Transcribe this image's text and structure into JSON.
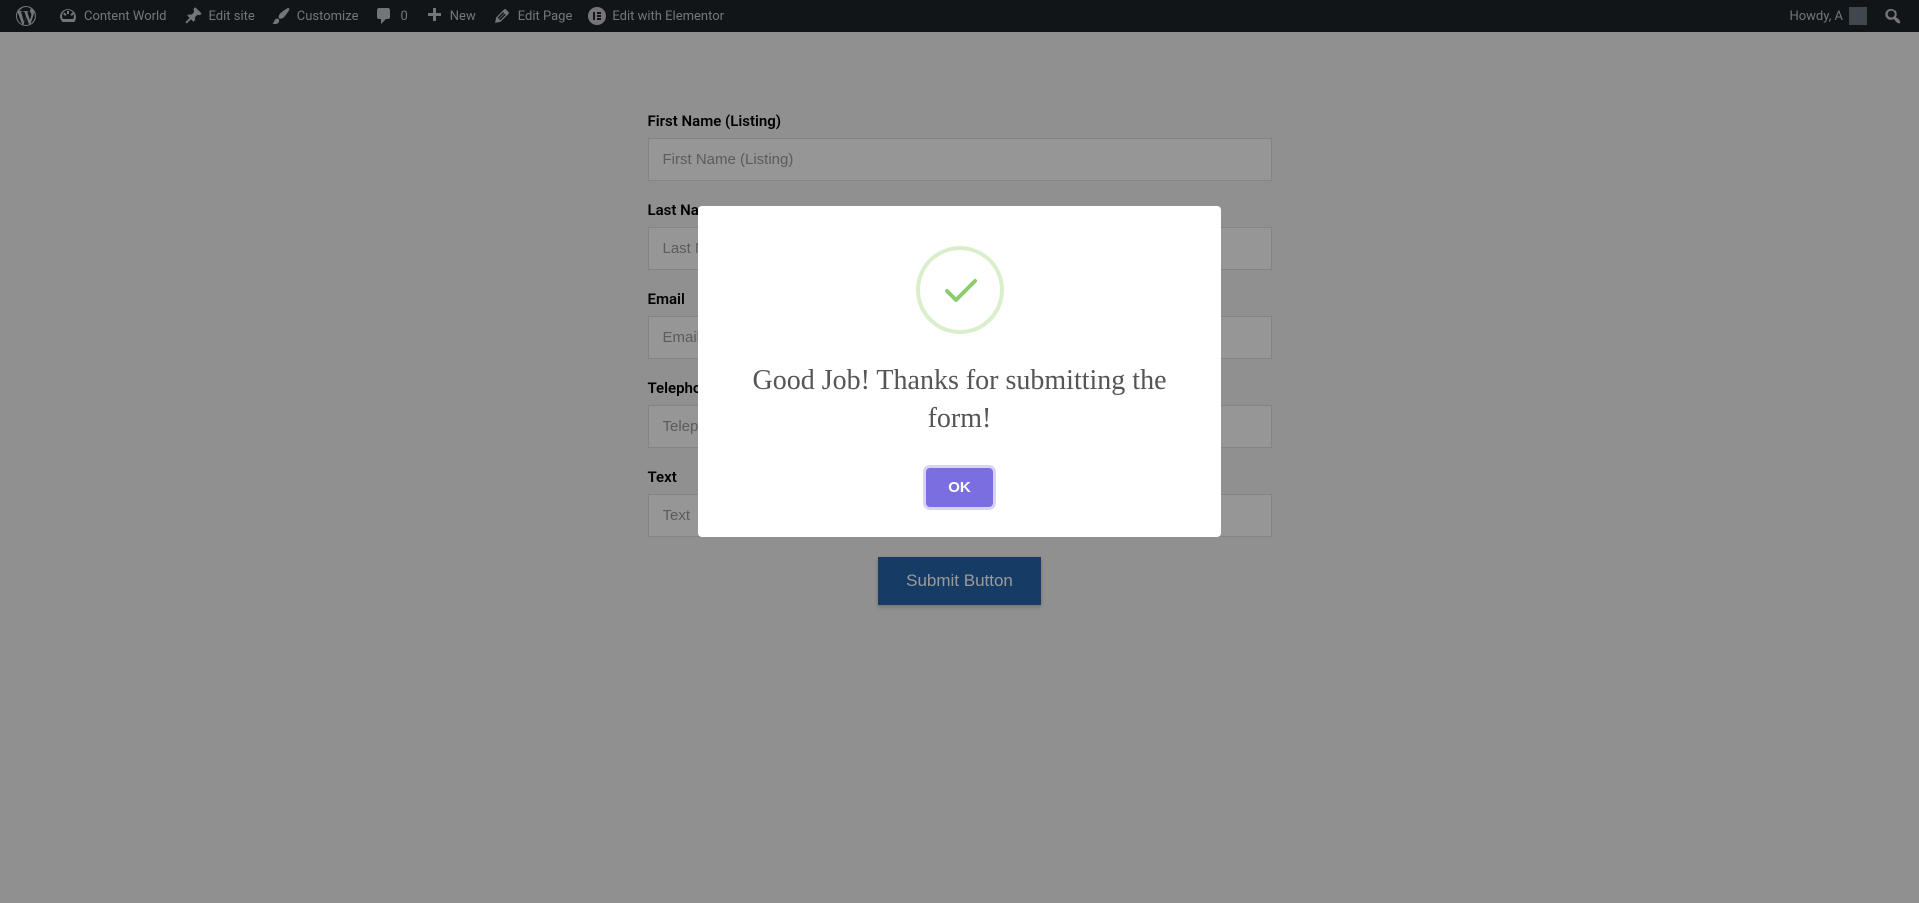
{
  "admin_bar": {
    "site_name": "Content World",
    "edit_site": "Edit site",
    "customize": "Customize",
    "comments_count": "0",
    "new": "New",
    "edit_page": "Edit Page",
    "edit_elementor": "Edit with Elementor",
    "greeting": "Howdy, A"
  },
  "form": {
    "fields": [
      {
        "label": "First Name (Listing)",
        "placeholder": "First Name (Listing)"
      },
      {
        "label": "Last Name",
        "placeholder": "Last Name"
      },
      {
        "label": "Email",
        "placeholder": "Email"
      },
      {
        "label": "Telephone",
        "placeholder": "Telephone"
      },
      {
        "label": "Text",
        "placeholder": "Text"
      }
    ],
    "submit_label": "Submit Button"
  },
  "modal": {
    "title": "Good Job! Thanks for submitting the form!",
    "ok_label": "OK"
  }
}
